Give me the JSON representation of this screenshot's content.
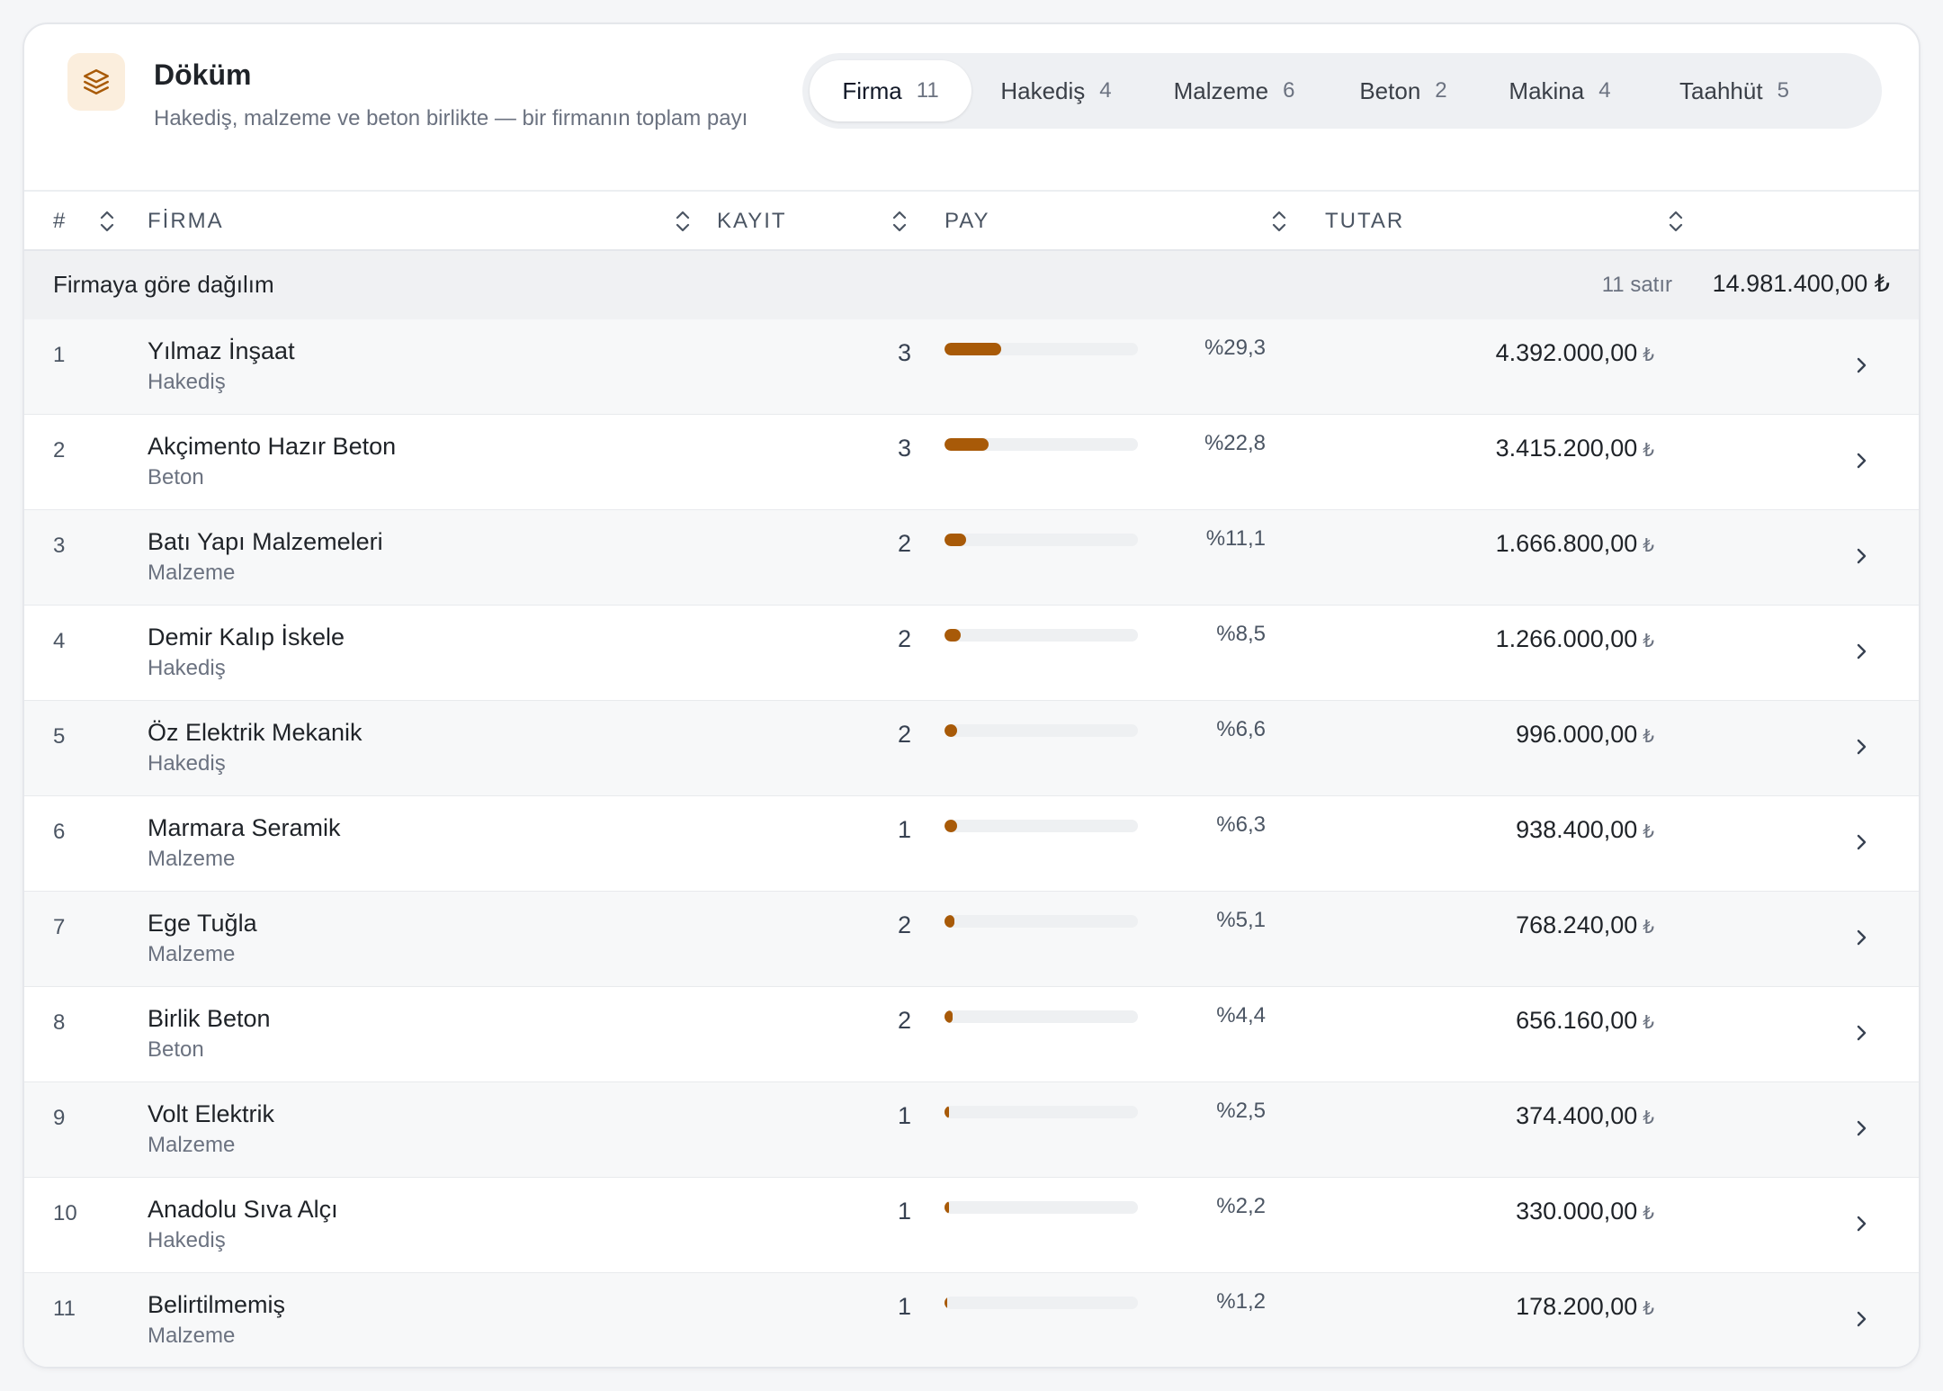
{
  "header": {
    "title": "Döküm",
    "subtitle": "Hakediş, malzeme ve beton birlikte — bir firmanın toplam payı"
  },
  "tabs": [
    {
      "label": "Firma",
      "count": "11",
      "active": true
    },
    {
      "label": "Hakediş",
      "count": "4",
      "active": false
    },
    {
      "label": "Malzeme",
      "count": "6",
      "active": false
    },
    {
      "label": "Beton",
      "count": "2",
      "active": false
    },
    {
      "label": "Makina",
      "count": "4",
      "active": false
    },
    {
      "label": "Taahhüt",
      "count": "5",
      "active": false
    }
  ],
  "columns": {
    "index": "#",
    "firma": "FİRMA",
    "kayit": "KAYIT",
    "pay": "PAY",
    "tutar": "TUTAR"
  },
  "group": {
    "label": "Firmaya göre dağılım",
    "count": "11 satır",
    "total": "14.981.400,00 ₺"
  },
  "currency_symbol": "₺",
  "accent_color": "#a85a08",
  "rows": [
    {
      "index": "1",
      "name": "Yılmaz İnşaat",
      "category": "Hakediş",
      "kayit": "3",
      "pay": "%29,3",
      "share": 29.3,
      "tutar": "4.392.000,00"
    },
    {
      "index": "2",
      "name": "Akçimento Hazır Beton",
      "category": "Beton",
      "kayit": "3",
      "pay": "%22,8",
      "share": 22.8,
      "tutar": "3.415.200,00"
    },
    {
      "index": "3",
      "name": "Batı Yapı Malzemeleri",
      "category": "Malzeme",
      "kayit": "2",
      "pay": "%11,1",
      "share": 11.1,
      "tutar": "1.666.800,00"
    },
    {
      "index": "4",
      "name": "Demir Kalıp İskele",
      "category": "Hakediş",
      "kayit": "2",
      "pay": "%8,5",
      "share": 8.5,
      "tutar": "1.266.000,00"
    },
    {
      "index": "5",
      "name": "Öz Elektrik Mekanik",
      "category": "Hakediş",
      "kayit": "2",
      "pay": "%6,6",
      "share": 6.6,
      "tutar": "996.000,00"
    },
    {
      "index": "6",
      "name": "Marmara Seramik",
      "category": "Malzeme",
      "kayit": "1",
      "pay": "%6,3",
      "share": 6.3,
      "tutar": "938.400,00"
    },
    {
      "index": "7",
      "name": "Ege Tuğla",
      "category": "Malzeme",
      "kayit": "2",
      "pay": "%5,1",
      "share": 5.1,
      "tutar": "768.240,00"
    },
    {
      "index": "8",
      "name": "Birlik Beton",
      "category": "Beton",
      "kayit": "2",
      "pay": "%4,4",
      "share": 4.4,
      "tutar": "656.160,00"
    },
    {
      "index": "9",
      "name": "Volt Elektrik",
      "category": "Malzeme",
      "kayit": "1",
      "pay": "%2,5",
      "share": 2.5,
      "tutar": "374.400,00"
    },
    {
      "index": "10",
      "name": "Anadolu Sıva Alçı",
      "category": "Hakediş",
      "kayit": "1",
      "pay": "%2,2",
      "share": 2.2,
      "tutar": "330.000,00"
    },
    {
      "index": "11",
      "name": "Belirtilmemiş",
      "category": "Malzeme",
      "kayit": "1",
      "pay": "%1,2",
      "share": 1.2,
      "tutar": "178.200,00"
    }
  ]
}
